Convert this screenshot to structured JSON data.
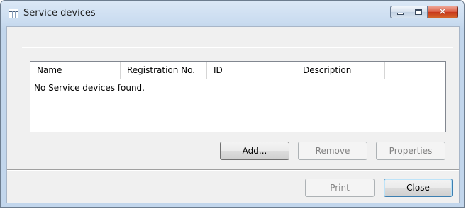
{
  "window": {
    "title": "Service devices"
  },
  "list": {
    "columns": [
      "Name",
      "Registration No.",
      "ID",
      "Description",
      ""
    ],
    "empty_message": "No Service devices found."
  },
  "buttons": {
    "add": "Add...",
    "remove": "Remove",
    "properties": "Properties",
    "print": "Print",
    "close": "Close"
  },
  "button_states": {
    "add": "enabled",
    "remove": "disabled",
    "properties": "disabled",
    "print": "disabled",
    "close": "enabled"
  },
  "icons": {
    "window": "window-app-icon",
    "minimize": "minimize-icon",
    "maximize": "maximize-icon",
    "close": "close-icon"
  },
  "colors": {
    "title_bar": "#cadcf0",
    "client_background": "#f0f0f0",
    "close_button": "#c7371b"
  }
}
